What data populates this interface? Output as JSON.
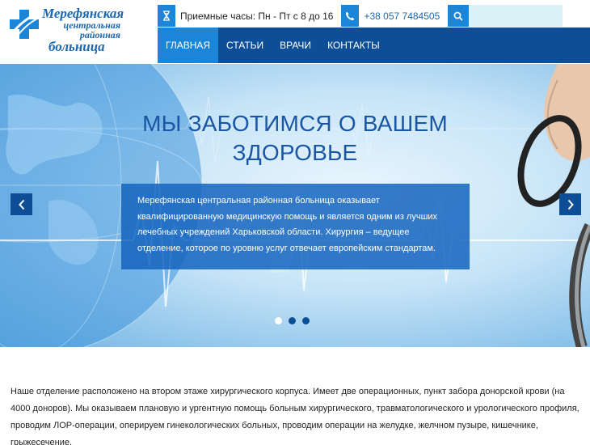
{
  "logo": {
    "line1": "Мерефянская",
    "line2": "центральная",
    "line3": "районная",
    "line4": "больница",
    "icon": "medical-cross-icon"
  },
  "topbar": {
    "hours_icon": "hourglass-icon",
    "hours": "Приемные часы: Пн - Пт с 8 до 16",
    "phone_icon": "phone-icon",
    "phone": "+38 057 7484505",
    "search_icon": "search-icon",
    "search_placeholder": ""
  },
  "nav": {
    "items": [
      {
        "label": "ГЛАВНАЯ",
        "active": true
      },
      {
        "label": "СТАТЬИ",
        "active": false
      },
      {
        "label": "ВРАЧИ",
        "active": false
      },
      {
        "label": "КОНТАКТЫ",
        "active": false
      }
    ]
  },
  "hero": {
    "title_line1": "МЫ ЗАБОТИМСЯ О ВАШЕМ",
    "title_line2": "ЗДОРОВЬЕ",
    "text": "Мерефянская центральная районная больница оказывает квалифицированную медицинскую помощь и является одним из лучших лечебных учреждений Харьковской области. Хирургия – ведущее отделение, которое по уровню услуг отвечает европейским стандартам.",
    "prev_icon": "chevron-left-icon",
    "next_icon": "chevron-right-icon",
    "slides_count": 3,
    "active_slide": 1
  },
  "content": {
    "paragraph": "Наше отделение расположено на втором этаже хирургического корпуса. Имеет две операционных, пункт забора донорской крови (на 4000 доноров). Мы оказываем плановую и ургентную помощь больным хирургического, травматологического и урологического профиля, проводим ЛОР-операции, оперируем гинекологических больных, проводим операции на желудке, желчном пузыре, кишечнике, грыжесечение."
  },
  "colors": {
    "brand_dark": "#0e4e96",
    "brand_accent": "#1b86d8",
    "logo_blue": "#1b67b0",
    "search_bg": "#d9f1f7"
  }
}
